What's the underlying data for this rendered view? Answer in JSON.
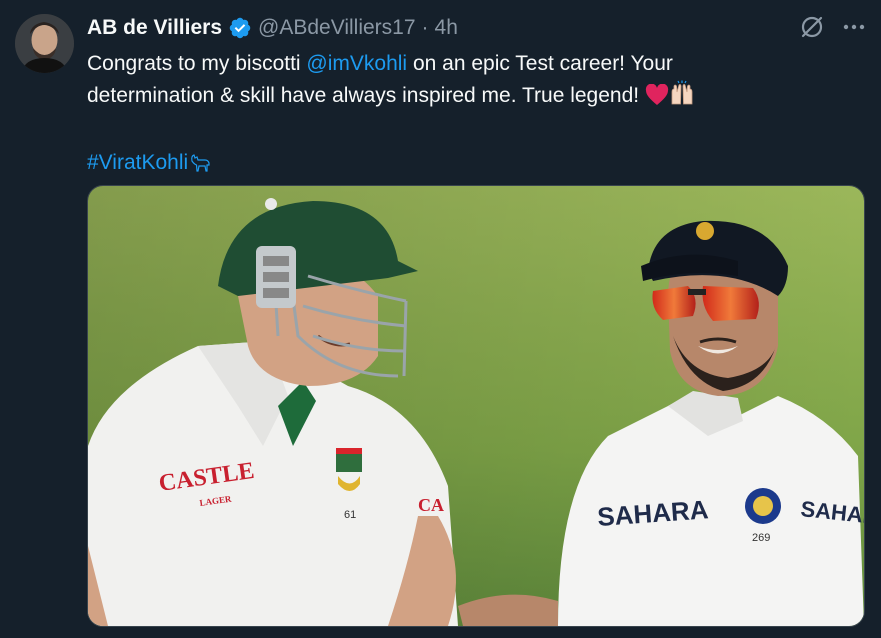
{
  "author": {
    "name": "AB de Villiers",
    "handle": "@ABdeVilliers17",
    "separator": "·",
    "time": "4h"
  },
  "tweet": {
    "text_before_mention": "Congrats to my biscotti ",
    "mention": "@imVkohli",
    "text_after_mention": " on an epic Test career! Your determination & skill have always inspired me. True legend!",
    "hashtag": "#ViratKohli"
  },
  "media": {
    "left_jersey": {
      "sponsor": "CASTLE",
      "sponsor_sub": "LAGER",
      "number": "61",
      "partial_text": "CA"
    },
    "right_jersey": {
      "sponsor": "SAHARA",
      "sponsor_right": "SAHAR",
      "number": "269"
    }
  },
  "icons": {
    "verified": "verified-badge-icon",
    "grok": "grok-icon",
    "more": "more-icon"
  },
  "colors": {
    "background": "#15202b",
    "accent": "#1d9bf0",
    "secondary_text": "#8b98a5"
  }
}
